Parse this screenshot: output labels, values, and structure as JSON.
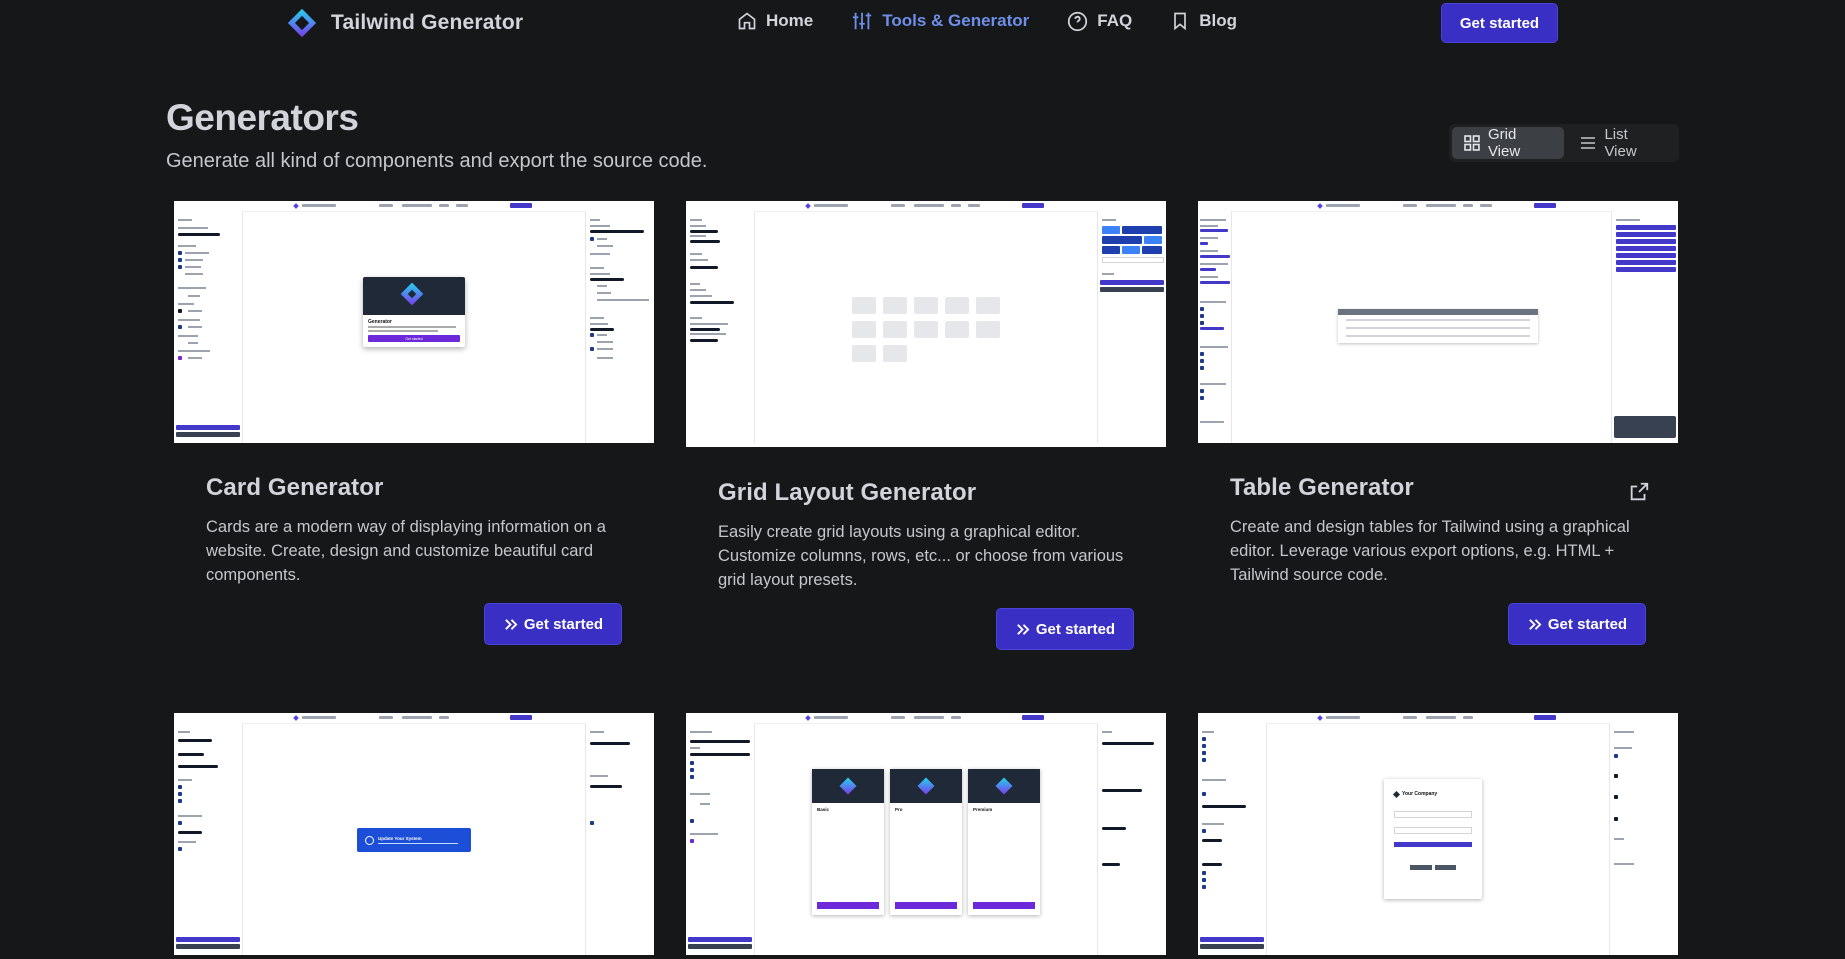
{
  "nav": {
    "brand": "Tailwind Generator",
    "links": [
      {
        "label": "Home",
        "icon": "home-icon"
      },
      {
        "label": "Tools & Generator",
        "icon": "sliders-icon",
        "active": true
      },
      {
        "label": "FAQ",
        "icon": "help-circle-icon"
      },
      {
        "label": "Blog",
        "icon": "bookmark-icon"
      }
    ],
    "cta": "Get started"
  },
  "header": {
    "title": "Generators",
    "subtitle": "Generate all kind of components and export the source code."
  },
  "view_toggle": {
    "grid": "Grid View",
    "list": "List View",
    "selected": "grid"
  },
  "cards": [
    {
      "title": "Card Generator",
      "description": "Cards are a modern way of displaying information on a website. Create, design and customize beautiful card components.",
      "button": "Get started",
      "preview": {
        "card_title": "Generator",
        "button": "Get started"
      }
    },
    {
      "title": "Grid Layout Generator",
      "description": "Easily create grid layouts using a graphical editor. Customize columns, rows, etc... or choose from various grid layout presets.",
      "button": "Get started"
    },
    {
      "title": "Table Generator",
      "description": "Create and design tables for Tailwind using a graphical editor. Leverage various export options, e.g. HTML + Tailwind source code.",
      "button": "Get started",
      "external_icon": "external-link-icon"
    }
  ],
  "previews_row2": [
    {
      "alert_title": "Update Your System"
    },
    {
      "plans": [
        "Basic",
        "Pro",
        "Premium"
      ]
    },
    {
      "company": "Your Company"
    }
  ],
  "colors": {
    "background": "#161718",
    "primary": "#3a2fc4",
    "active_link": "#6e8fe9"
  }
}
